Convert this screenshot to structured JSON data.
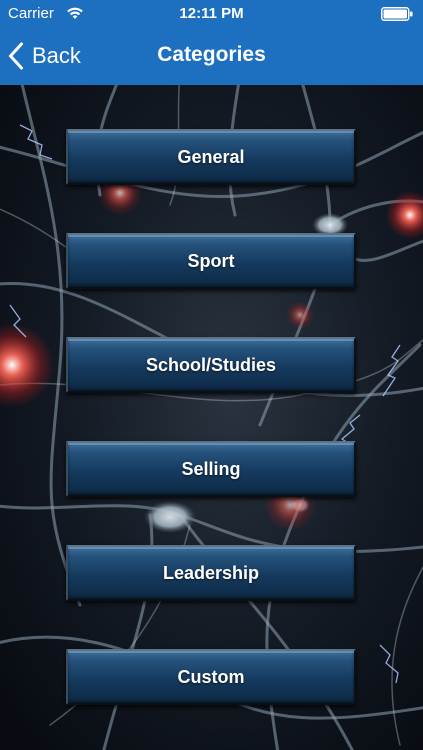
{
  "status_bar": {
    "carrier": "Carrier",
    "time": "12:11 PM",
    "wifi_icon": "wifi-icon",
    "battery_icon": "battery-icon"
  },
  "nav": {
    "back_label": "Back",
    "title": "Categories"
  },
  "categories": [
    {
      "label": "General"
    },
    {
      "label": "Sport"
    },
    {
      "label": "School/Studies"
    },
    {
      "label": "Selling"
    },
    {
      "label": "Leadership"
    },
    {
      "label": "Custom"
    }
  ],
  "colors": {
    "nav_bar": "#1d6fc0",
    "button_top": "#3e6e9a",
    "button_bottom": "#0d2945",
    "background": "#0a0f18"
  }
}
